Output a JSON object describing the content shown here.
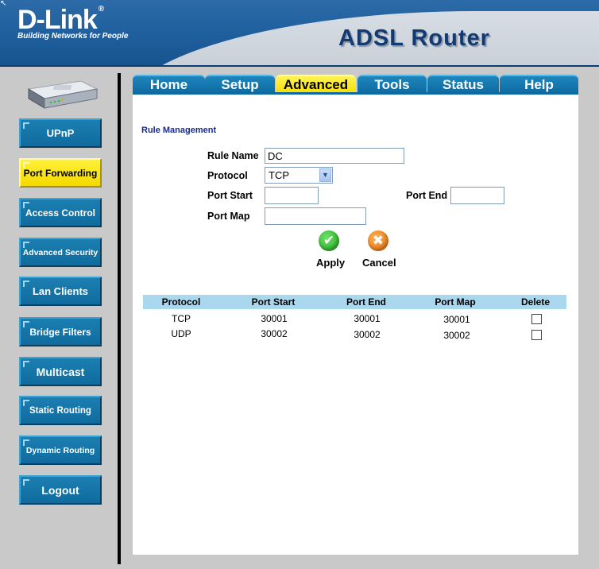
{
  "header": {
    "logo": "D-Link",
    "logo_mark": "®",
    "tagline": "Building Networks for People",
    "product": "ADSL Router"
  },
  "device_image": "router-device",
  "sidebar": {
    "items": [
      {
        "label": "UPnP",
        "active": false
      },
      {
        "label": "Port Forwarding",
        "active": true
      },
      {
        "label": "Access Control",
        "active": false
      },
      {
        "label": "Advanced Security",
        "active": false
      },
      {
        "label": "Lan Clients",
        "active": false
      },
      {
        "label": "Bridge Filters",
        "active": false
      },
      {
        "label": "Multicast",
        "active": false
      },
      {
        "label": "Static Routing",
        "active": false
      },
      {
        "label": "Dynamic Routing",
        "active": false
      },
      {
        "label": "Logout",
        "active": false
      }
    ]
  },
  "tabs": [
    {
      "label": "Home",
      "active": false
    },
    {
      "label": "Setup",
      "active": false
    },
    {
      "label": "Advanced",
      "active": true
    },
    {
      "label": "Tools",
      "active": false
    },
    {
      "label": "Status",
      "active": false
    },
    {
      "label": "Help",
      "active": false
    }
  ],
  "form": {
    "section_title": "Rule Management",
    "rule_name_label": "Rule Name",
    "rule_name_value": "DC",
    "protocol_label": "Protocol",
    "protocol_value": "TCP",
    "port_start_label": "Port Start",
    "port_start_value": "",
    "port_end_label": "Port End",
    "port_end_value": "",
    "port_map_label": "Port Map",
    "port_map_value": "",
    "apply_label": "Apply",
    "cancel_label": "Cancel"
  },
  "table": {
    "headers": [
      "Protocol",
      "Port Start",
      "Port End",
      "Port Map",
      "Delete"
    ],
    "rows": [
      {
        "protocol": "TCP",
        "port_start": "30001",
        "port_end": "30001",
        "port_map": "30001",
        "delete": false
      },
      {
        "protocol": "UDP",
        "port_start": "30002",
        "port_end": "30002",
        "port_map": "30002",
        "delete": false
      }
    ]
  },
  "colors": {
    "header_blue": "#1f5e9c",
    "button_blue": "#0f6b9e",
    "active_yellow": "#f4d800",
    "table_header": "#a9d7ee",
    "section_title": "#1a2a8c"
  }
}
